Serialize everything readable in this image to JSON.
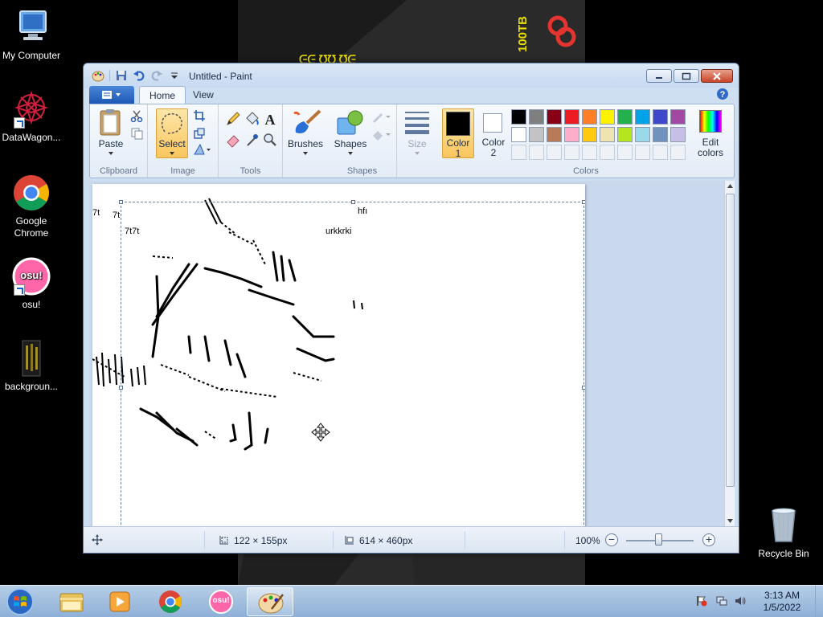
{
  "desktop": {
    "icons": [
      {
        "label": "My Computer"
      },
      {
        "label": "DataWagon..."
      },
      {
        "label": "Google\nChrome"
      },
      {
        "label": "osu!"
      },
      {
        "label": "backgroun..."
      },
      {
        "label": "Recycle Bin"
      }
    ],
    "osu_text": "osu!",
    "wallpaper_text": [
      "100TB",
      "ᕮᕮ ᘮᘮ ᘮᕮ"
    ]
  },
  "paint": {
    "title": "Untitled - Paint",
    "tabs": [
      "Home",
      "View"
    ],
    "groups": {
      "clipboard": {
        "label": "Clipboard",
        "paste": "Paste"
      },
      "image": {
        "label": "Image",
        "select": "Select"
      },
      "tools": {
        "label": "Tools"
      },
      "brushes": {
        "label": "Brushes"
      },
      "shapes": {
        "label": "Shapes",
        "shapes_btn": "Shapes"
      },
      "size": {
        "label": "Size"
      },
      "colors": {
        "label": "Colors",
        "color1": "Color\n1",
        "color2": "Color\n2",
        "edit": "Edit\ncolors",
        "palette_row1": [
          "#000000",
          "#7f7f7f",
          "#880015",
          "#ed1c24",
          "#ff7f27",
          "#fff200",
          "#22b14c",
          "#00a2e8",
          "#3f48cc",
          "#a349a4"
        ],
        "palette_row2": [
          "#ffffff",
          "#c3c3c3",
          "#b97a57",
          "#ffaec9",
          "#ffc90e",
          "#efe4b0",
          "#b5e61d",
          "#99d9ea",
          "#7092be",
          "#c8bfe7"
        ]
      }
    },
    "canvas_text": {
      "t1": "7t",
      "t2": "7t",
      "t3": "7t7t",
      "t4": "hfı",
      "t5": "urkkrki"
    },
    "status": {
      "selection_size": "122 × 155px",
      "canvas_size": "614 × 460px",
      "zoom": "100%"
    }
  },
  "taskbar": {
    "osu_label": "osu!",
    "time": "3:13 AM",
    "date": "1/5/2022"
  }
}
